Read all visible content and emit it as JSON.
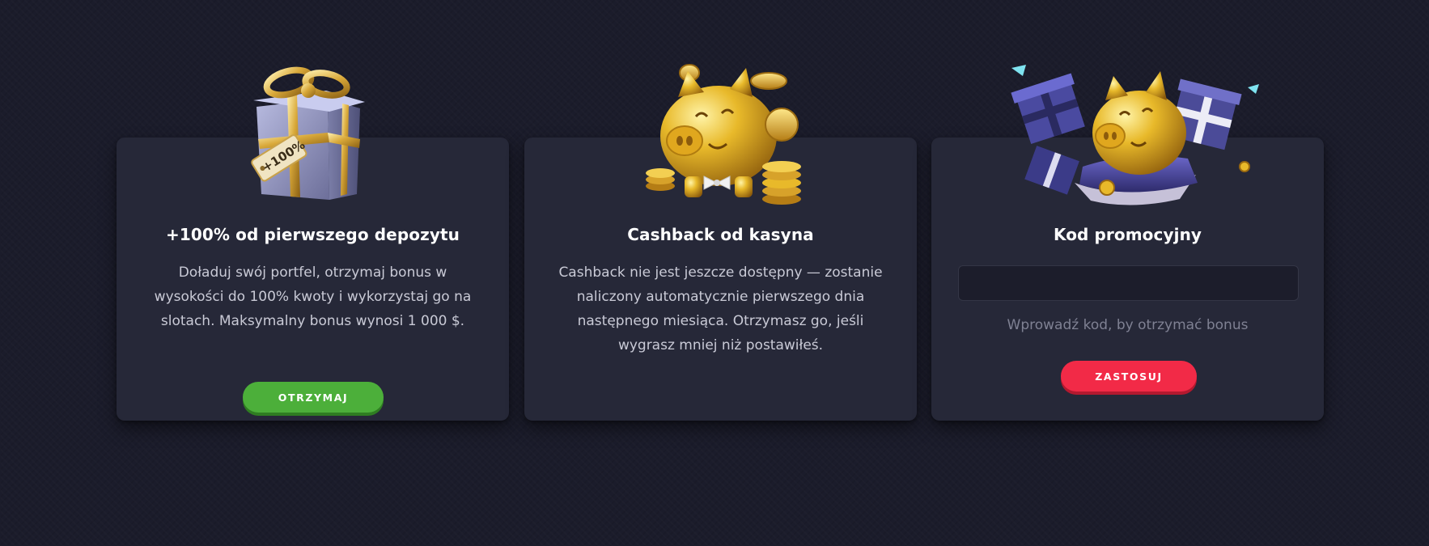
{
  "cards": [
    {
      "title": "+100% od pierwszego depozytu",
      "text": "Doładuj swój portfel, otrzymaj bonus w wysokości do 100% kwoty i wykorzystaj go na slotach. Maksymalny bonus wynosi 1 000 $.",
      "button_label": "OTRZYMAJ",
      "illustration": "gift-box-icon",
      "tag_text": "+100%"
    },
    {
      "title": "Cashback od kasyna",
      "text": "Cashback nie jest jeszcze dostępny — zostanie naliczony automatycznie pierwszego dnia następnego miesiąca. Otrzymasz go, jeśli wygrasz mniej niż postawiłeś.",
      "illustration": "piggy-bank-coins-icon"
    },
    {
      "title": "Kod promocyjny",
      "input_value": "",
      "hint": "Wprowadź kod, by otrzymać bonus",
      "button_label": "ZASTOSUJ",
      "illustration": "piggy-bank-gifts-icon"
    }
  ],
  "colors": {
    "background": "#1b1c2b",
    "card": "#262838",
    "green_button": "#4caf3a",
    "red_button": "#f22a47",
    "gold": "#e7b92c"
  }
}
